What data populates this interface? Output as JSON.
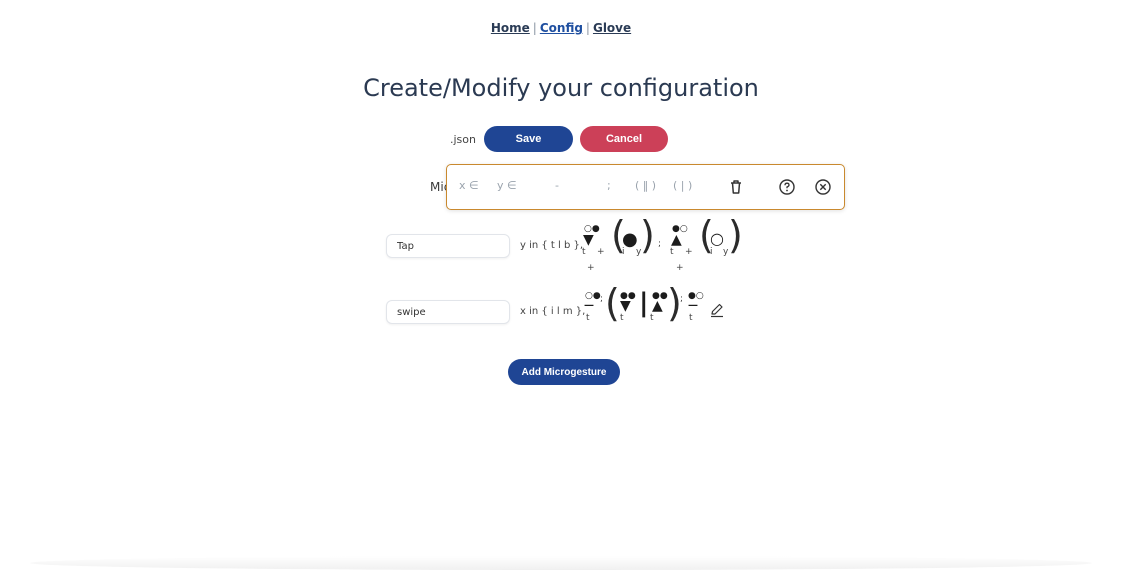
{
  "nav": {
    "home": "Home",
    "config": "Config",
    "glove": "Glove",
    "separator": "|"
  },
  "page": {
    "title": "Create/Modify your configuration"
  },
  "file": {
    "extension": ".json",
    "save_label": "Save",
    "cancel_label": "Cancel"
  },
  "microgestures": {
    "label_partial": "Mic",
    "toolbar": {
      "x_in": "x ∈",
      "y_in": "y ∈",
      "dash": "-",
      "semicolon": ";",
      "double_bar_group": "( ‖ )",
      "bar_group": "( | )",
      "icons": [
        "trash-icon",
        "help-icon",
        "close-icon"
      ]
    },
    "rows": [
      {
        "name": "Tap",
        "rule": "y in { t l b },",
        "glyph_subs": [
          "t",
          "+",
          "i",
          "y",
          ";",
          "t",
          "+",
          "i",
          "y",
          "+",
          "+"
        ]
      },
      {
        "name": "swipe",
        "rule": "x in { i l m },",
        "glyph_subs": [
          "t",
          ";",
          "t",
          "t",
          ";",
          "t"
        ]
      }
    ],
    "add_label": "Add Microgesture"
  },
  "colors": {
    "primary": "#1f4594",
    "danger": "#cc4058",
    "highlight_border": "#c9892e"
  }
}
